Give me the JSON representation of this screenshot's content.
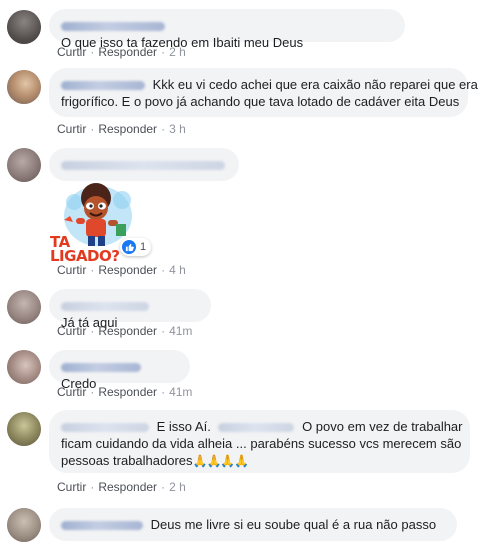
{
  "comments": [
    {
      "text": "O que isso ta fazendo em Ibaiti meu Deus",
      "like": "Curtir",
      "reply": "Responder",
      "time": "2 h"
    },
    {
      "line1": "Kkk eu vi cedo achei que era caixão não reparei que era",
      "line2": "frigorífico. E o povo já achando que tava lotado de cadáver eita Deus",
      "like": "Curtir",
      "reply": "Responder",
      "time": "3 h"
    },
    {
      "sticker_text": "TA LIGADO?",
      "reaction_count": "1",
      "reaction_icon": "like-icon",
      "like": "Curtir",
      "reply": "Responder",
      "time": "4 h"
    },
    {
      "text": "Já tá aqui",
      "like": "Curtir",
      "reply": "Responder",
      "time": "41m"
    },
    {
      "text": "Credo",
      "like": "Curtir",
      "reply": "Responder",
      "time": "41m"
    },
    {
      "line1_a": "E isso Aí.",
      "line1_b": "O povo em vez de trabalhar",
      "line2": "ficam cuidando da vida alheia ... parabéns sucesso vcs merecem são",
      "line3": "pessoas trabalhadores",
      "emoji": "🙏🙏🙏🙏",
      "like": "Curtir",
      "reply": "Responder",
      "time": "2 h"
    },
    {
      "text": "Deus me livre si eu soube qual é a rua não passo"
    }
  ],
  "colors": {
    "bubble": "#f2f3f5",
    "link": "#385898",
    "meta": "#90949c",
    "like_blue": "#1877f2"
  }
}
